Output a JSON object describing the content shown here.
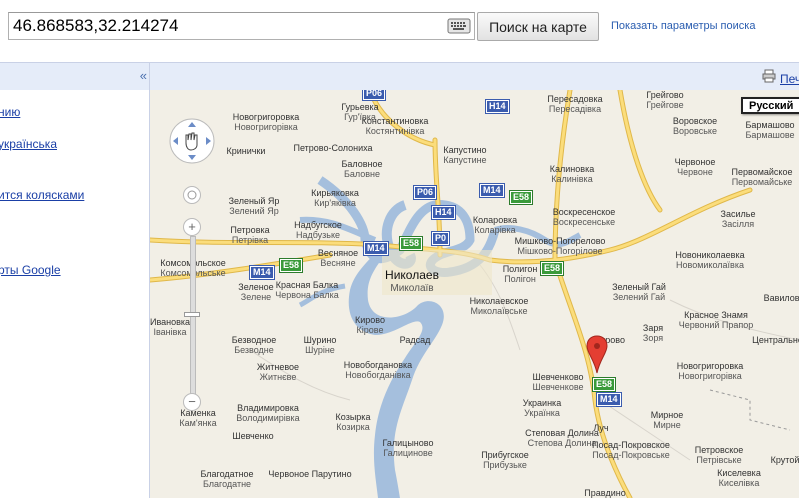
{
  "search": {
    "value": "46.868583,32.214274",
    "button_label": "Поиск на карте",
    "params_link": "Показать параметры поиска"
  },
  "sidebar": {
    "collapse_glyph": "«",
    "links": [
      "нию",
      "українська",
      "ится колясками",
      "рты Google"
    ]
  },
  "map_header": {
    "print_label": "Печ"
  },
  "map": {
    "language_box": "Русский",
    "colors": {
      "water": "#a5bfdd",
      "land": "#f2efe6",
      "road": "#fbdd7c",
      "road_outline": "#e0b84a",
      "shield_blue": "#3b5cae",
      "shield_green": "#3a9a3a",
      "marker": "#e43e32"
    },
    "places": [
      {
        "ru": "Гурьевка",
        "uk": "Гур'ївка"
      },
      {
        "ru": "Новогригоровка",
        "uk": "Новогригорівка"
      },
      {
        "ru": "Константиновка",
        "uk": "Костянтинівка"
      },
      {
        "ru": "Кринички",
        "uk": ""
      },
      {
        "ru": "Петрово-Солониха",
        "uk": ""
      },
      {
        "ru": "Баловное",
        "uk": "Баловне"
      },
      {
        "ru": "Капустино",
        "uk": "Капустине"
      },
      {
        "ru": "Пересадовка",
        "uk": "Пересадівка"
      },
      {
        "ru": "Грейгово",
        "uk": "Грейгове"
      },
      {
        "ru": "Воровское",
        "uk": "Воровське"
      },
      {
        "ru": "Бармашово",
        "uk": "Бармашове"
      },
      {
        "ru": "Калиновка",
        "uk": "Калинівка"
      },
      {
        "ru": "Червоное",
        "uk": "Червоне"
      },
      {
        "ru": "Первомайское",
        "uk": "Первомайське"
      },
      {
        "ru": "Кирьяковка",
        "uk": "Кир'яківка"
      },
      {
        "ru": "Зеленый Яр",
        "uk": "Зелений Яр"
      },
      {
        "ru": "Надбугское",
        "uk": "Надбузьке"
      },
      {
        "ru": "Коларовка",
        "uk": "Коларівка"
      },
      {
        "ru": "Воскресенское",
        "uk": "Воскресенське"
      },
      {
        "ru": "Петровка",
        "uk": "Петрівка"
      },
      {
        "ru": "Весняное",
        "uk": "Весняне"
      },
      {
        "ru": "Мишково-Погорелово",
        "uk": "Мішково-Погорілове"
      },
      {
        "ru": "Засилье",
        "uk": "Засілля"
      },
      {
        "ru": "Новониколаевка",
        "uk": "Новомиколаївка"
      },
      {
        "ru": "Комсомольское",
        "uk": "Комсомольське"
      },
      {
        "ru": "Николаев",
        "uk": "Миколаїв"
      },
      {
        "ru": "Полигон",
        "uk": "Полігон"
      },
      {
        "ru": "Зеленое",
        "uk": "Зелене"
      },
      {
        "ru": "Зеленый Гай",
        "uk": "Зелений Гай"
      },
      {
        "ru": "Красная Балка",
        "uk": "Червона Балка"
      },
      {
        "ru": "Николаевское",
        "uk": "Миколаївське"
      },
      {
        "ru": "Вавилово",
        "uk": ""
      },
      {
        "ru": "Ивановка",
        "uk": "Іванівка"
      },
      {
        "ru": "Кирово",
        "uk": "Кірове"
      },
      {
        "ru": "Радсад",
        "uk": ""
      },
      {
        "ru": "Кирово",
        "uk": ""
      },
      {
        "ru": "Заря",
        "uk": "Зоря"
      },
      {
        "ru": "Красное Знамя",
        "uk": "Червоний Прапор"
      },
      {
        "ru": "Безводное",
        "uk": "Безводне"
      },
      {
        "ru": "Шурино",
        "uk": "Шуріне"
      },
      {
        "ru": "Центральное",
        "uk": ""
      },
      {
        "ru": "Новогригоровка",
        "uk": "Новогригорівка"
      },
      {
        "ru": "Новобогдановка",
        "uk": "Новобогданівка"
      },
      {
        "ru": "Житневое",
        "uk": "Житнєве"
      },
      {
        "ru": "Шевченково",
        "uk": "Шевченкове"
      },
      {
        "ru": "Каменка",
        "uk": "Кам'янка"
      },
      {
        "ru": "Владимировка",
        "uk": "Володимирівка"
      },
      {
        "ru": "Украинка",
        "uk": "Українка"
      },
      {
        "ru": "Мирное",
        "uk": "Мирне"
      },
      {
        "ru": "Шевченко",
        "uk": ""
      },
      {
        "ru": "Козырка",
        "uk": "Козирка"
      },
      {
        "ru": "Луч",
        "uk": ""
      },
      {
        "ru": "Галицыново",
        "uk": "Галицинове"
      },
      {
        "ru": "Прибугское",
        "uk": "Прибузьке"
      },
      {
        "ru": "Степовая Долина",
        "uk": "Степова Долина"
      },
      {
        "ru": "Посад-Покровское",
        "uk": "Посад-Покровське"
      },
      {
        "ru": "Петровское",
        "uk": "Петрівське"
      },
      {
        "ru": "Благодатное",
        "uk": "Благодатне"
      },
      {
        "ru": "Червоное Парутино",
        "uk": ""
      },
      {
        "ru": "Киселевка",
        "uk": "Киселівка"
      },
      {
        "ru": "Правдино",
        "uk": ""
      },
      {
        "ru": "Крутой",
        "uk": ""
      }
    ],
    "shields": [
      "Р06",
      "H14",
      "Р06",
      "М14",
      "E58",
      "H14",
      "Р0",
      "М14",
      "E58",
      "М14",
      "E58",
      "E58",
      "E58",
      "М14"
    ]
  },
  "icons": {
    "keyboard": "keyboard-icon",
    "print": "print-icon",
    "pan": "pan-control-icon",
    "marker": "location-marker-icon"
  }
}
